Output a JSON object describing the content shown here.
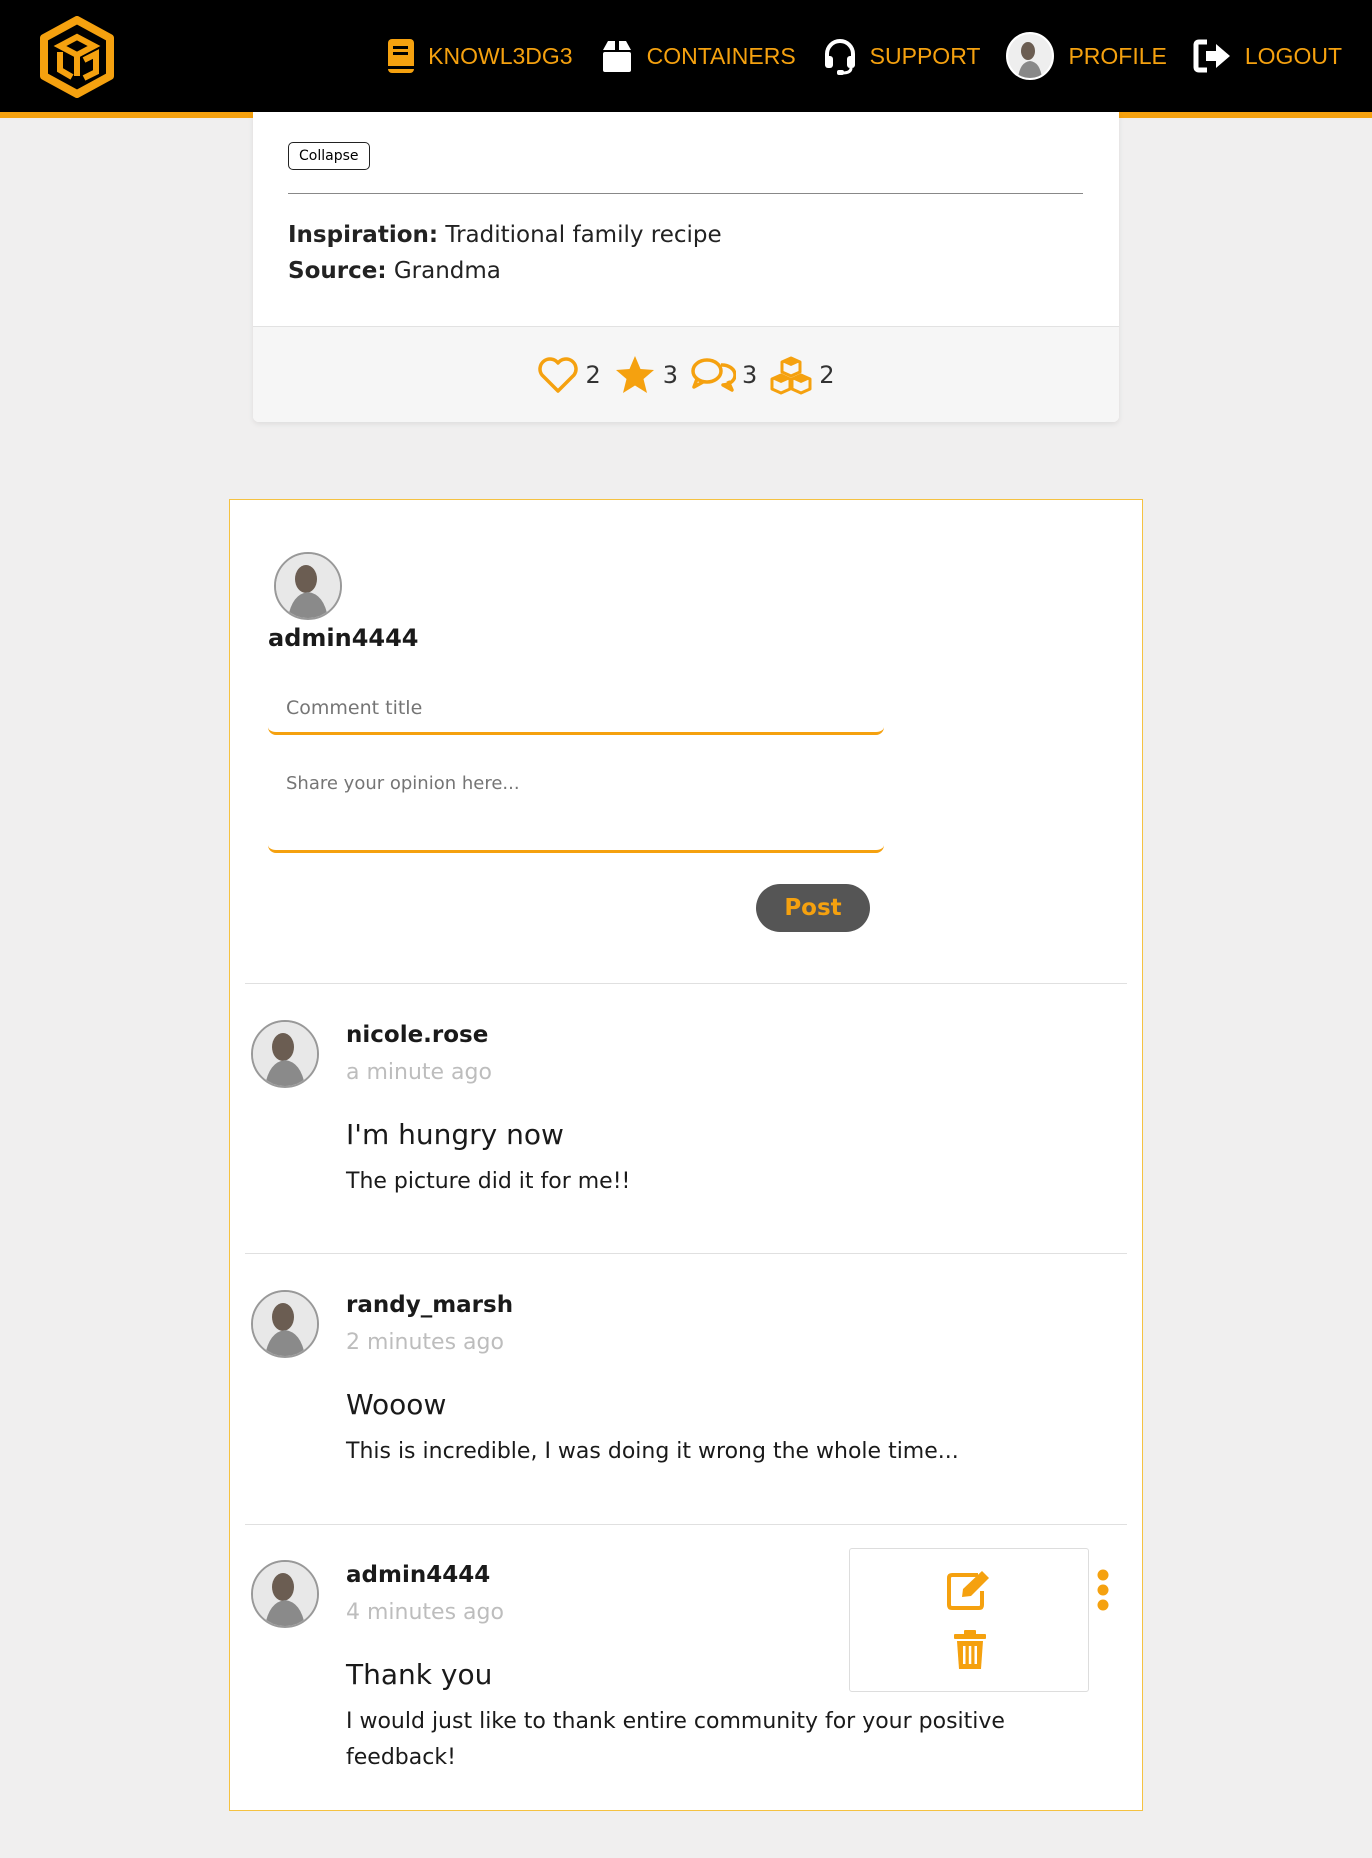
{
  "nav": {
    "brand": "KNOWL3DG3",
    "containers": "CONTAINERS",
    "support": "SUPPORT",
    "profile": "PROFILE",
    "logout": "LOGOUT"
  },
  "recipe": {
    "collapse_label": "Collapse",
    "inspiration_label": "Inspiration:",
    "inspiration_value": "Traditional family recipe",
    "source_label": "Source:",
    "source_value": "Grandma",
    "stats": {
      "likes": "2",
      "stars": "3",
      "comments": "3",
      "containers": "2"
    }
  },
  "composer": {
    "username": "admin4444",
    "title_placeholder": "Comment title",
    "body_placeholder": "Share your opinion here...",
    "post_label": "Post"
  },
  "comments": [
    {
      "user": "nicole.rose",
      "time": "a minute ago",
      "title": "I'm hungry now",
      "body": "The picture did it for me!!"
    },
    {
      "user": "randy_marsh",
      "time": "2 minutes ago",
      "title": "Wooow",
      "body": "This is incredible, I was doing it wrong the whole time..."
    },
    {
      "user": "admin4444",
      "time": "4 minutes ago",
      "title": "Thank you",
      "body": "I would just like to thank entire community for your positive feedback!"
    }
  ],
  "colors": {
    "accent": "#f5a10f",
    "navbar": "#000000",
    "background": "#f0efef",
    "muted_text": "#bdbdbd",
    "post_button": "#555555"
  },
  "icons": {
    "logo": "cube-logo-icon",
    "brand": "book-icon",
    "containers": "box-icon",
    "support": "headset-icon",
    "logout": "sign-out-icon",
    "like": "heart-icon",
    "star": "star-icon",
    "comment": "comments-icon",
    "container": "cubes-icon",
    "edit": "edit-icon",
    "delete": "trash-icon",
    "menu": "kebab-menu-icon"
  }
}
